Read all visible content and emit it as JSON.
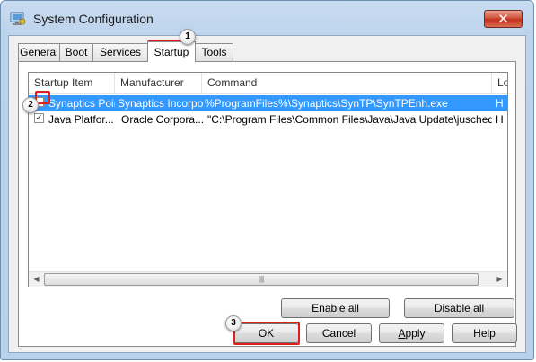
{
  "window": {
    "title": "System Configuration",
    "close_glyph": "✕",
    "app_icon": "system-config-icon"
  },
  "tabs": [
    {
      "label": "General",
      "active": false
    },
    {
      "label": "Boot",
      "active": false
    },
    {
      "label": "Services",
      "active": false
    },
    {
      "label": "Startup",
      "active": true
    },
    {
      "label": "Tools",
      "active": false
    }
  ],
  "startup_list": {
    "columns": [
      "Startup Item",
      "Manufacturer",
      "Command",
      "Lo"
    ],
    "rows": [
      {
        "checked": false,
        "selected": true,
        "item": "Synaptics Poin",
        "manufacturer": "Synaptics Incorpora",
        "command": "%ProgramFiles%\\Synaptics\\SynTP\\SynTPEnh.exe",
        "location": "H"
      },
      {
        "checked": true,
        "selected": false,
        "item": "Java Platfor...",
        "manufacturer": "Oracle Corpora...",
        "command": "\"C:\\Program Files\\Common Files\\Java\\Java Update\\jusched.e...",
        "location": "H"
      }
    ],
    "scroll_thumb_glyph": "|||"
  },
  "buttons": {
    "enable_all": "Enable all",
    "disable_all": "Disable all",
    "ok": "OK",
    "cancel": "Cancel",
    "apply": "Apply",
    "help": "Help"
  },
  "annotations": [
    "1",
    "2",
    "3"
  ],
  "colors": {
    "selection": "#3399ff",
    "highlight": "#e0201b"
  }
}
